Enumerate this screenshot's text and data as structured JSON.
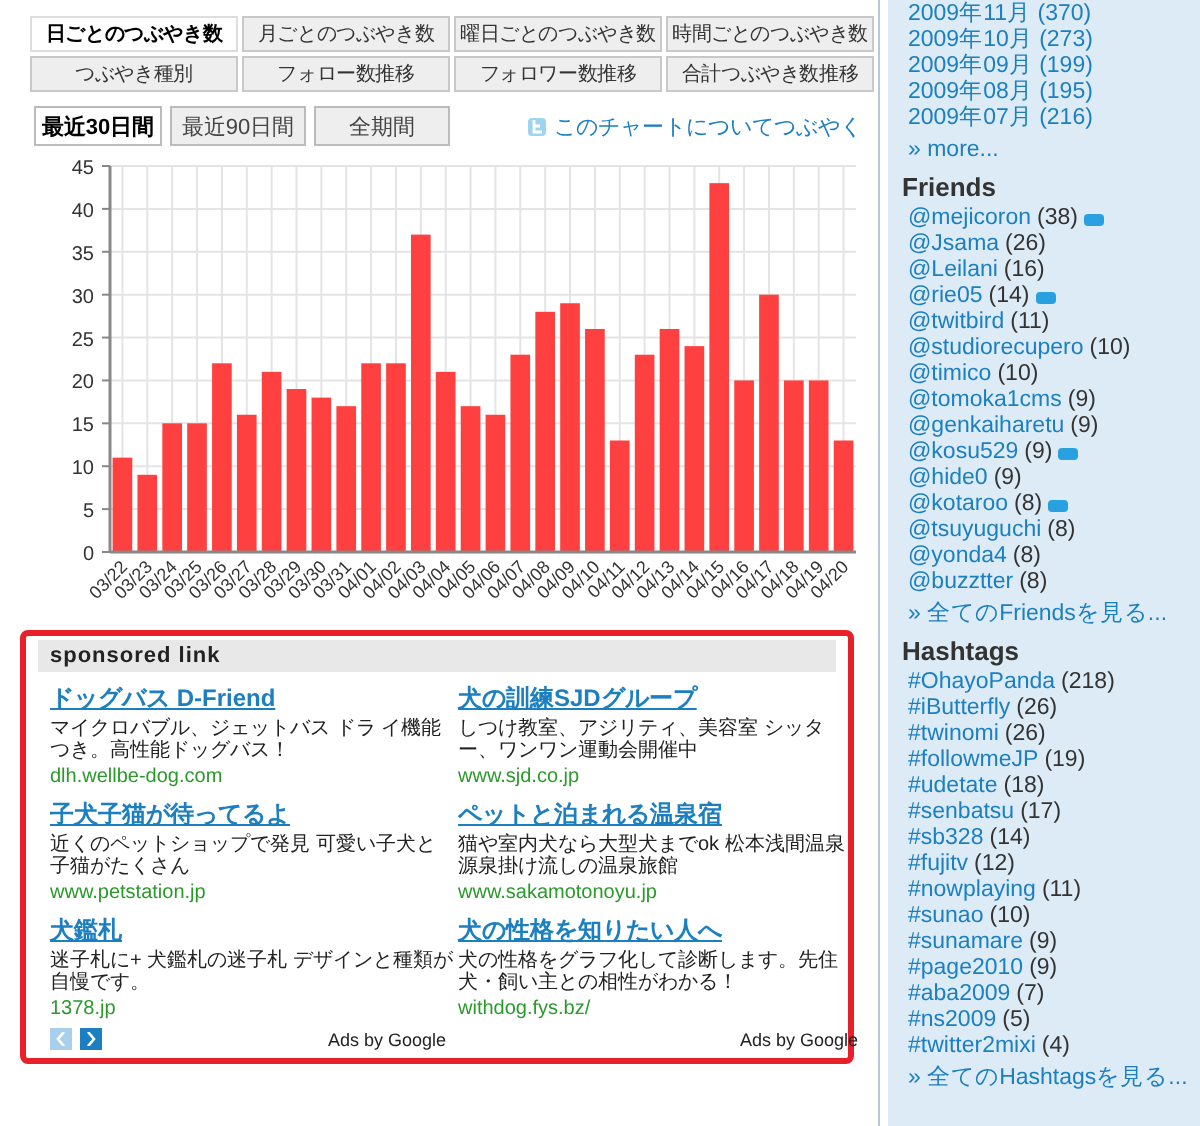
{
  "stat_tabs": [
    {
      "label": "日ごとのつぶやき数",
      "selected": true
    },
    {
      "label": "月ごとのつぶやき数",
      "selected": false
    },
    {
      "label": "曜日ごとのつぶやき数",
      "selected": false
    },
    {
      "label": "時間ごとのつぶやき数",
      "selected": false
    },
    {
      "label": "つぶやき種別",
      "selected": false
    },
    {
      "label": "フォロー数推移",
      "selected": false
    },
    {
      "label": "フォロワー数推移",
      "selected": false
    },
    {
      "label": "合計つぶやき数推移",
      "selected": false
    }
  ],
  "range_tabs": [
    {
      "label": "最近30日間",
      "selected": true
    },
    {
      "label": "最近90日間",
      "selected": false
    },
    {
      "label": "全期間",
      "selected": false
    }
  ],
  "tweet_chart_link": "このチャートについてつぶやく",
  "chart_data": {
    "type": "bar",
    "categories": [
      "03/22",
      "03/23",
      "03/24",
      "03/25",
      "03/26",
      "03/27",
      "03/28",
      "03/29",
      "03/30",
      "03/31",
      "04/01",
      "04/02",
      "04/03",
      "04/04",
      "04/05",
      "04/06",
      "04/07",
      "04/08",
      "04/09",
      "04/10",
      "04/11",
      "04/12",
      "04/13",
      "04/14",
      "04/15",
      "04/16",
      "04/17",
      "04/18",
      "04/19",
      "04/20"
    ],
    "series": [
      {
        "color": "#ff4040",
        "values": [
          11,
          9,
          15,
          15,
          22,
          16,
          21,
          19,
          18,
          17,
          22,
          22,
          37,
          21,
          17,
          16,
          23,
          28,
          29,
          26,
          13,
          23,
          26,
          24,
          43,
          20,
          30,
          20,
          20,
          13
        ]
      }
    ],
    "ylim": [
      0,
      45
    ],
    "grid": true,
    "yticks": [
      0,
      5,
      10,
      15,
      20,
      25,
      30,
      35,
      40,
      45
    ]
  },
  "ads": {
    "title": "sponsored link",
    "items": [
      {
        "title": "ドッグバス D-Friend",
        "description": "マイクロバブル、ジェットバス ドラ イ機能つき。高性能ドッグバス！",
        "url": "dlh.wellbe-dog.com"
      },
      {
        "title": "犬の訓練SJDグループ",
        "description": "しつけ教室、アジリティ、美容室 シッター、ワンワン運動会開催中",
        "url": "www.sjd.co.jp"
      },
      {
        "title": "子犬子猫が待ってるよ",
        "description": "近くのペットショップで発見 可愛い子犬と子猫がたくさん",
        "url": "www.petstation.jp"
      },
      {
        "title": "ペットと泊まれる温泉宿",
        "description": "猫や室内犬なら大型犬までok 松本浅間温泉源泉掛け流しの温泉旅館",
        "url": "www.sakamotonoyu.jp"
      },
      {
        "title": "犬鑑札",
        "description": "迷子札に+ 犬鑑札の迷子札 デザインと種類が自慢です。",
        "url": "1378.jp"
      },
      {
        "title": "犬の性格を知りたい人へ",
        "description": "犬の性格をグラフ化して診断します。先住犬・飼い主との相性がわかる！",
        "url": "withdog.fys.bz/"
      }
    ],
    "prev_disabled": true,
    "next_disabled": false,
    "ads_by": [
      "Ads by Google",
      "Ads by Google"
    ]
  },
  "sidebar": {
    "archive": [
      {
        "label": "2009年11月",
        "count": "(370)"
      },
      {
        "label": "2009年10月",
        "count": "(273)"
      },
      {
        "label": "2009年09月",
        "count": "(199)"
      },
      {
        "label": "2009年08月",
        "count": "(195)"
      },
      {
        "label": "2009年07月",
        "count": "(216)"
      }
    ],
    "archive_more": "» more...",
    "friends_title": "Friends",
    "friends": [
      {
        "name": "@mejicoron",
        "count": "(38)",
        "badge": true
      },
      {
        "name": "@Jsama",
        "count": "(26)",
        "badge": false
      },
      {
        "name": "@Leilani",
        "count": "(16)",
        "badge": false
      },
      {
        "name": "@rie05",
        "count": "(14)",
        "badge": true
      },
      {
        "name": "@twitbird",
        "count": "(11)",
        "badge": false
      },
      {
        "name": "@studiorecupero",
        "count": "(10)",
        "badge": false
      },
      {
        "name": "@timico",
        "count": "(10)",
        "badge": false
      },
      {
        "name": "@tomoka1cms",
        "count": "(9)",
        "badge": false
      },
      {
        "name": "@genkaiharetu",
        "count": "(9)",
        "badge": false
      },
      {
        "name": "@kosu529",
        "count": "(9)",
        "badge": true
      },
      {
        "name": "@hide0",
        "count": "(9)",
        "badge": false
      },
      {
        "name": "@kotaroo",
        "count": "(8)",
        "badge": true
      },
      {
        "name": "@tsuyuguchi",
        "count": "(8)",
        "badge": false
      },
      {
        "name": "@yonda4",
        "count": "(8)",
        "badge": false
      },
      {
        "name": "@buzztter",
        "count": "(8)",
        "badge": false
      }
    ],
    "friends_more": "» 全てのFriendsを見る...",
    "hashtags_title": "Hashtags",
    "hashtags": [
      {
        "name": "#OhayoPanda",
        "count": "(218)"
      },
      {
        "name": "#iButterfly",
        "count": "(26)"
      },
      {
        "name": "#twinomi",
        "count": "(26)"
      },
      {
        "name": "#followmeJP",
        "count": "(19)"
      },
      {
        "name": "#udetate",
        "count": "(18)"
      },
      {
        "name": "#senbatsu",
        "count": "(17)"
      },
      {
        "name": "#sb328",
        "count": "(14)"
      },
      {
        "name": "#fujitv",
        "count": "(12)"
      },
      {
        "name": "#nowplaying",
        "count": "(11)"
      },
      {
        "name": "#sunao",
        "count": "(10)"
      },
      {
        "name": "#sunamare",
        "count": "(9)"
      },
      {
        "name": "#page2010",
        "count": "(9)"
      },
      {
        "name": "#aba2009",
        "count": "(7)"
      },
      {
        "name": "#ns2009",
        "count": "(5)"
      },
      {
        "name": "#twitter2mixi",
        "count": "(4)"
      }
    ],
    "hashtags_more": "» 全てのHashtagsを見る..."
  }
}
